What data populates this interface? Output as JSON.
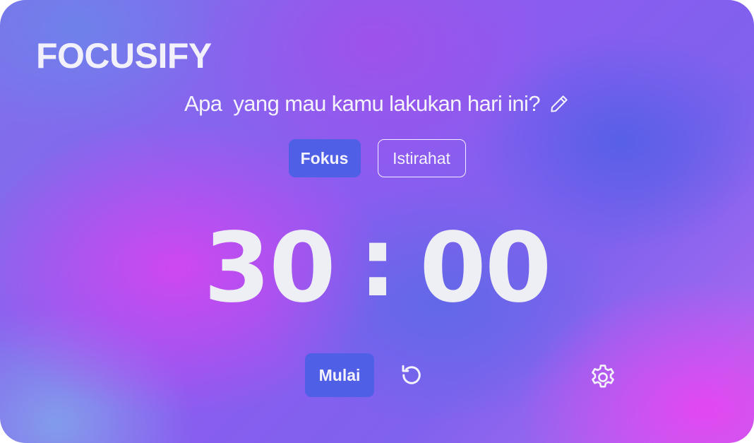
{
  "app": {
    "title": "FOCUSIFY"
  },
  "task": {
    "prompt": "Apa  yang mau kamu lakukan hari ini?",
    "edit_icon": "pencil-icon"
  },
  "modes": [
    {
      "label": "Fokus",
      "active": true
    },
    {
      "label": "Istirahat",
      "active": false
    }
  ],
  "timer": {
    "minutes": "30",
    "separator": ":",
    "seconds": "00"
  },
  "controls": {
    "start_label": "Mulai",
    "reset_icon": "reset-icon",
    "settings_icon": "gear-icon"
  },
  "colors": {
    "button_blue": "#4f5fe6",
    "text_light": "#f4f2fc"
  }
}
